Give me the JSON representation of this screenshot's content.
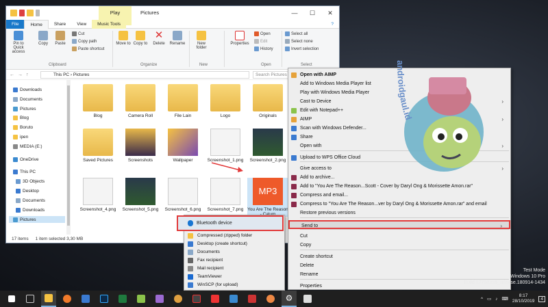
{
  "explorer": {
    "title": "Pictures",
    "context_tab": "Play",
    "tabs": {
      "file": "File",
      "home": "Home",
      "share": "Share",
      "view": "View",
      "music_tools": "Music Tools"
    },
    "ribbon": {
      "pin": "Pin to Quick access",
      "copy": "Copy",
      "paste": "Paste",
      "cut": "Cut",
      "copy_path": "Copy path",
      "paste_shortcut": "Paste shortcut",
      "move_to": "Move to",
      "copy_to": "Copy to",
      "delete": "Delete",
      "rename": "Rename",
      "new_folder": "New folder",
      "properties": "Properties",
      "open": "Open",
      "edit": "Edit",
      "history": "History",
      "select_all": "Select all",
      "select_none": "Select none",
      "invert_selection": "Invert selection",
      "groups": {
        "clipboard": "Clipboard",
        "organize": "Organize",
        "new": "New",
        "open": "Open",
        "select": "Select"
      }
    },
    "address": {
      "this_pc": "This PC",
      "pictures": "Pictures",
      "search_placeholder": "Search Pictures"
    },
    "nav": [
      "Downloads",
      "Documents",
      "Pictures",
      "Blog",
      "Boruto",
      "ipen",
      "MEDIA (E:)",
      "OneDrive",
      "This PC",
      "3D Objects",
      "Desktop",
      "Documents",
      "Downloads",
      "Pictures"
    ],
    "files": [
      "Blog",
      "Camera Roll",
      "File Lain",
      "Logo",
      "Originals",
      "Saved Pictures",
      "Screenshots",
      "Wallpaper",
      "Screenshot_1.png",
      "Screenshot_2.png",
      "Screenshot_4.png",
      "Screenshot_5.png",
      "Screenshot_6.png",
      "Screenshot_7.png",
      "You Are The Reason - Calum"
    ],
    "mp3_label": "MP3",
    "status": {
      "items": "17 items",
      "selected": "1 item selected  3,30 MB"
    }
  },
  "context_menu": {
    "items": [
      "Open with AIMP",
      "Add to Windows Media Player list",
      "Play with Windows Media Player",
      "Cast to Device",
      "Edit with Notepad++",
      "AIMP",
      "Scan with Windows Defender...",
      "Share",
      "Open with",
      "Upload to WPS Office Cloud",
      "Give access to",
      "Add to archive...",
      "Add to \"You Are The Reason...Scott - Cover by Daryl Ong & Morissette Amon.rar\"",
      "Compress and email...",
      "Compress to \"You Are The Reason...ver by Daryl Ong & Morissette Amon.rar\" and email",
      "Restore previous versions",
      "Send to",
      "Cut",
      "Copy",
      "Create shortcut",
      "Delete",
      "Rename",
      "Properties"
    ]
  },
  "send_to": {
    "bluetooth": "Bluetooth device",
    "items": [
      "Compressed (zipped) folder",
      "Desktop (create shortcut)",
      "Documents",
      "Fax recipient",
      "Mail recipient",
      "TeamViewer",
      "WinSCP (for upload)"
    ]
  },
  "watermark": "androidgaul.id",
  "desktop": {
    "line1": "Test Mode",
    "line2": "Windows 10 Pro",
    "line3": "Build 17763.rs5_release.180914-1434"
  },
  "taskbar": {
    "time": "8:17",
    "date": "28/10/2019",
    "notifications": "4"
  },
  "colors": {
    "accent": "#1979ca",
    "highlight_border": "#e23a3a",
    "mp3_tile": "#ee5a2a"
  }
}
